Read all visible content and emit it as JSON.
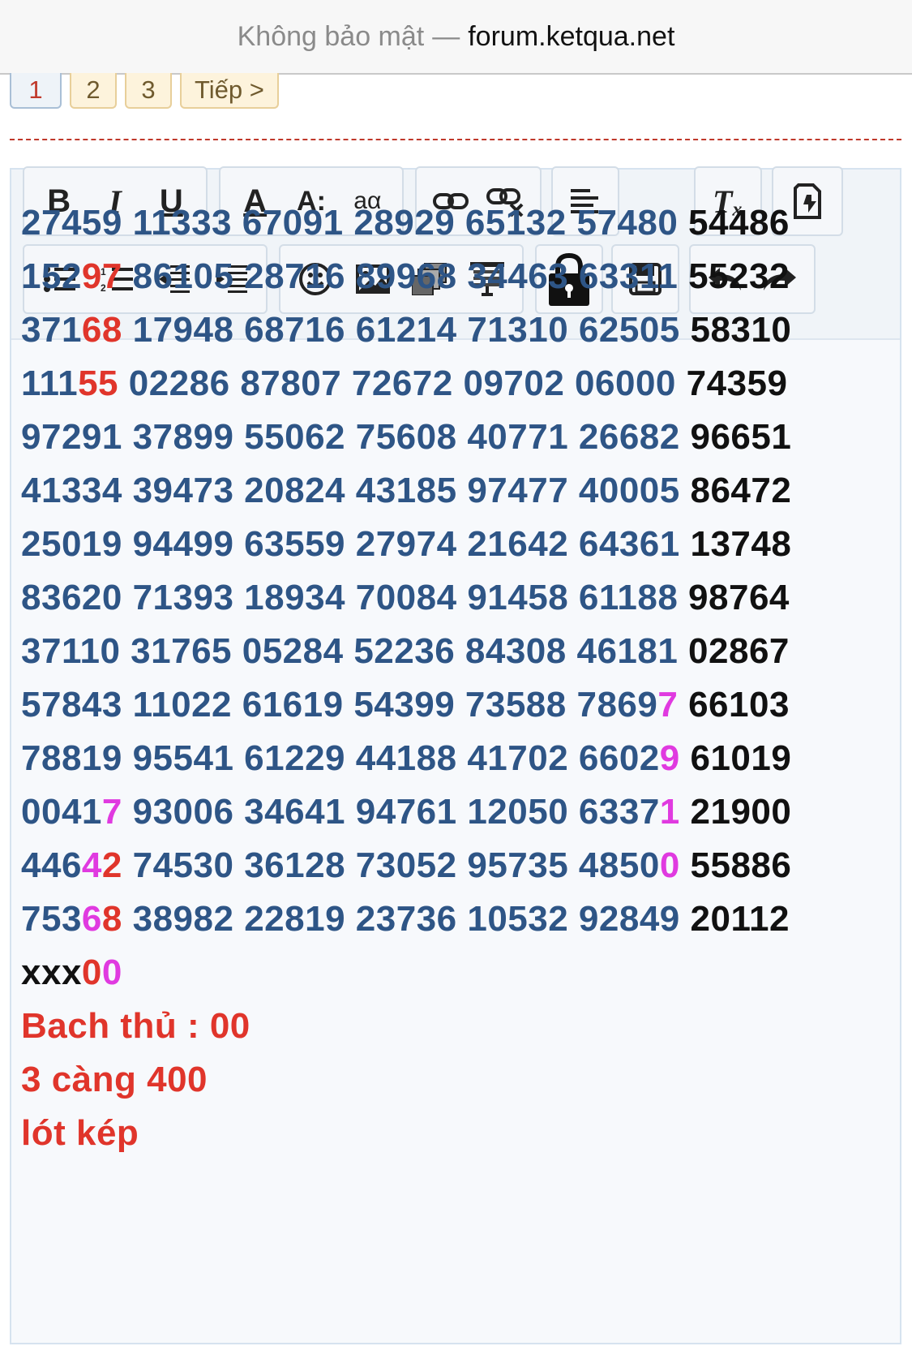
{
  "browser": {
    "security": "Không bảo mật",
    "separator": "—",
    "domain": "forum.ketqua.net"
  },
  "pagination": {
    "pages": [
      "1",
      "2",
      "3"
    ],
    "current": "1",
    "next": "Tiếp >"
  },
  "toolbar": {
    "row1": [
      "bold",
      "italic",
      "underline",
      "text-color",
      "font-size",
      "font-family",
      "link",
      "unlink",
      "align",
      "remove-format",
      "bbcode-toggle"
    ],
    "row2": [
      "bullet-list",
      "numbered-list",
      "outdent",
      "indent",
      "smilie",
      "image",
      "media",
      "insert-more",
      "lock",
      "save-draft",
      "undo",
      "redo"
    ],
    "labels": {
      "bold": "B",
      "italic": "I",
      "underline": "U",
      "text_color": "A",
      "font_size": "A:",
      "font_family": "aα",
      "remove_format": "Tₓ"
    }
  },
  "colors": {
    "number": "#2e5586",
    "black": "#111111",
    "red": "#e0352b",
    "pink": "#e03ae0",
    "divider": "#c0392b"
  },
  "grid": [
    [
      {
        "t": "27459",
        "c": "n"
      },
      {
        "t": " 11333",
        "c": "n"
      },
      {
        "t": " 67091",
        "c": "n"
      },
      {
        "t": " 28929",
        "c": "n"
      },
      {
        "t": " 65132",
        "c": "n"
      },
      {
        "t": " 57480",
        "c": "n"
      },
      {
        "t": " 54486",
        "c": "k"
      }
    ],
    [
      {
        "t": "152",
        "c": "n"
      },
      {
        "t": "97",
        "c": "r"
      },
      {
        "t": " 86105",
        "c": "n"
      },
      {
        "t": " 28716",
        "c": "n"
      },
      {
        "t": " 89968",
        "c": "n"
      },
      {
        "t": " 34463",
        "c": "n"
      },
      {
        "t": " 63311",
        "c": "n"
      },
      {
        "t": " 55232",
        "c": "k"
      }
    ],
    [
      {
        "t": "371",
        "c": "n"
      },
      {
        "t": "68",
        "c": "r"
      },
      {
        "t": " 17948",
        "c": "n"
      },
      {
        "t": " 68716",
        "c": "n"
      },
      {
        "t": " 61214",
        "c": "n"
      },
      {
        "t": " 71310",
        "c": "n"
      },
      {
        "t": " 62505",
        "c": "n"
      },
      {
        "t": " 58310",
        "c": "k"
      }
    ],
    [
      {
        "t": "111",
        "c": "n"
      },
      {
        "t": "55",
        "c": "r"
      },
      {
        "t": " 02286",
        "c": "n"
      },
      {
        "t": " 87807",
        "c": "n"
      },
      {
        "t": " 72672",
        "c": "n"
      },
      {
        "t": " 09702",
        "c": "n"
      },
      {
        "t": " 06000",
        "c": "n"
      },
      {
        "t": " 74359",
        "c": "k"
      }
    ],
    [
      {
        "t": "97291",
        "c": "n"
      },
      {
        "t": " 37899",
        "c": "n"
      },
      {
        "t": " 55062",
        "c": "n"
      },
      {
        "t": " 75608",
        "c": "n"
      },
      {
        "t": " 40771",
        "c": "n"
      },
      {
        "t": " 26682",
        "c": "n"
      },
      {
        "t": " 96651",
        "c": "k"
      }
    ],
    [
      {
        "t": "41334",
        "c": "n"
      },
      {
        "t": " 39473",
        "c": "n"
      },
      {
        "t": " 20824",
        "c": "n"
      },
      {
        "t": " 43185",
        "c": "n"
      },
      {
        "t": " 97477",
        "c": "n"
      },
      {
        "t": " 40005",
        "c": "n"
      },
      {
        "t": " 86472",
        "c": "k"
      }
    ],
    [
      {
        "t": "25019",
        "c": "n"
      },
      {
        "t": " 94499",
        "c": "n"
      },
      {
        "t": " 63559",
        "c": "n"
      },
      {
        "t": " 27974",
        "c": "n"
      },
      {
        "t": " 21642",
        "c": "n"
      },
      {
        "t": " 64361",
        "c": "n"
      },
      {
        "t": " 13748",
        "c": "k"
      }
    ],
    [
      {
        "t": "83620",
        "c": "n"
      },
      {
        "t": " 71393",
        "c": "n"
      },
      {
        "t": " 18934",
        "c": "n"
      },
      {
        "t": " 70084",
        "c": "n"
      },
      {
        "t": " 91458",
        "c": "n"
      },
      {
        "t": " 61188",
        "c": "n"
      },
      {
        "t": " 98764",
        "c": "k"
      }
    ],
    [
      {
        "t": "37110",
        "c": "n"
      },
      {
        "t": " 31765",
        "c": "n"
      },
      {
        "t": " 05284",
        "c": "n"
      },
      {
        "t": " 52236",
        "c": "n"
      },
      {
        "t": " 84308",
        "c": "n"
      },
      {
        "t": " 46181",
        "c": "n"
      },
      {
        "t": " 02867",
        "c": "k"
      }
    ],
    [
      {
        "t": "57843",
        "c": "n"
      },
      {
        "t": " 11022",
        "c": "n"
      },
      {
        "t": " 61619",
        "c": "n"
      },
      {
        "t": " 54399",
        "c": "n"
      },
      {
        "t": " 73588",
        "c": "n"
      },
      {
        "t": " 7869",
        "c": "n"
      },
      {
        "t": "7",
        "c": "p"
      },
      {
        "t": " 66103",
        "c": "k"
      }
    ],
    [
      {
        "t": "78819",
        "c": "n"
      },
      {
        "t": " 95541",
        "c": "n"
      },
      {
        "t": " 61229",
        "c": "n"
      },
      {
        "t": " 44188",
        "c": "n"
      },
      {
        "t": " 41702",
        "c": "n"
      },
      {
        "t": " 6602",
        "c": "n"
      },
      {
        "t": "9",
        "c": "p"
      },
      {
        "t": " 61019",
        "c": "k"
      }
    ],
    [
      {
        "t": "0041",
        "c": "n"
      },
      {
        "t": "7",
        "c": "p"
      },
      {
        "t": " 93006",
        "c": "n"
      },
      {
        "t": " 34641",
        "c": "n"
      },
      {
        "t": " 94761",
        "c": "n"
      },
      {
        "t": " 12050",
        "c": "n"
      },
      {
        "t": " 6337",
        "c": "n"
      },
      {
        "t": "1",
        "c": "p"
      },
      {
        "t": " 21900",
        "c": "k"
      }
    ],
    [
      {
        "t": "446",
        "c": "n"
      },
      {
        "t": "4",
        "c": "p"
      },
      {
        "t": "2",
        "c": "r"
      },
      {
        "t": " 74530",
        "c": "n"
      },
      {
        "t": " 36128",
        "c": "n"
      },
      {
        "t": " 73052",
        "c": "n"
      },
      {
        "t": " 95735",
        "c": "n"
      },
      {
        "t": " 4850",
        "c": "n"
      },
      {
        "t": "0",
        "c": "p"
      },
      {
        "t": " 55886",
        "c": "k"
      }
    ],
    [
      {
        "t": "753",
        "c": "n"
      },
      {
        "t": "6",
        "c": "p"
      },
      {
        "t": "8",
        "c": "r"
      },
      {
        "t": " 38982",
        "c": "n"
      },
      {
        "t": " 22819",
        "c": "n"
      },
      {
        "t": " 23736",
        "c": "n"
      },
      {
        "t": " 10532",
        "c": "n"
      },
      {
        "t": " 92849",
        "c": "n"
      },
      {
        "t": " 20112",
        "c": "k"
      }
    ],
    [
      {
        "t": "xxx",
        "c": "k"
      },
      {
        "t": "0",
        "c": "r"
      },
      {
        "t": "0",
        "c": "p"
      }
    ]
  ],
  "notes": {
    "bach_thu": "Bach thủ : 00",
    "ba_cang": "3 càng 400",
    "lot": "lót kép"
  }
}
